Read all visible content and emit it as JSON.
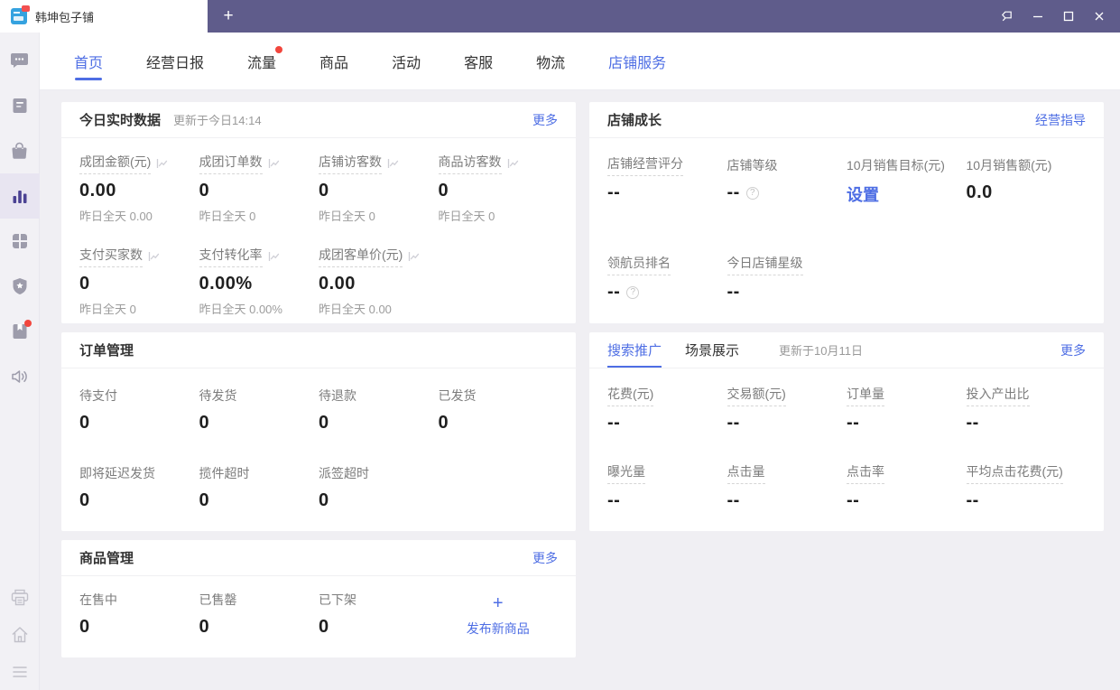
{
  "colors": {
    "accent_blue": "#4e6ee4",
    "titlebar_purple": "#5f5c8b",
    "sidebar_active_purple": "#4b4293",
    "badge_red": "#f2463d"
  },
  "window": {
    "tab_title": "韩坤包子铺",
    "new_tab_label": "+"
  },
  "sidebar": {
    "top_icons": [
      "chat-icon",
      "document-icon",
      "bag-icon",
      "bar-chart-icon",
      "grid-icon",
      "shield-icon",
      "book-icon",
      "speaker-icon"
    ],
    "active_icon": "bar-chart-icon",
    "bottom_icons": [
      "printer-icon",
      "home-icon",
      "menu-icon"
    ]
  },
  "nav": {
    "tabs": [
      {
        "label": "首页",
        "active": true
      },
      {
        "label": "经营日报"
      },
      {
        "label": "流量",
        "badge": true
      },
      {
        "label": "商品"
      },
      {
        "label": "活动"
      },
      {
        "label": "客服"
      },
      {
        "label": "物流"
      },
      {
        "label": "店铺服务",
        "highlight": true
      }
    ]
  },
  "realtime": {
    "title": "今日实时数据",
    "updated": "更新于今日14:14",
    "more": "更多",
    "metrics": [
      {
        "label": "成团金额(元)",
        "dashed": true,
        "chart_icon": true,
        "value": "0.00",
        "sub": "昨日全天 0.00"
      },
      {
        "label": "成团订单数",
        "dashed": true,
        "chart_icon": true,
        "value": "0",
        "sub": "昨日全天 0"
      },
      {
        "label": "店铺访客数",
        "dashed": true,
        "chart_icon": true,
        "value": "0",
        "sub": "昨日全天 0"
      },
      {
        "label": "商品访客数",
        "dashed": true,
        "chart_icon": true,
        "value": "0",
        "sub": "昨日全天 0"
      },
      {
        "label": "支付买家数",
        "dashed": true,
        "chart_icon": true,
        "value": "0",
        "sub": "昨日全天 0"
      },
      {
        "label": "支付转化率",
        "dashed": true,
        "chart_icon": true,
        "value": "0.00%",
        "sub": "昨日全天 0.00%"
      },
      {
        "label": "成团客单价(元)",
        "dashed": true,
        "chart_icon": true,
        "value": "0.00",
        "sub": "昨日全天 0.00"
      }
    ]
  },
  "growth": {
    "title": "店铺成长",
    "link": "经营指导",
    "metrics": [
      {
        "label": "店铺经营评分",
        "dashed": true,
        "value": "--"
      },
      {
        "label": "店铺等级",
        "value": "--",
        "help": true
      },
      {
        "label": "10月销售目标(元)",
        "action": "设置"
      },
      {
        "label": "10月销售额(元)",
        "value": "0.0"
      },
      {
        "label": "领航员排名",
        "dashed": true,
        "value": "--",
        "help": true
      },
      {
        "label": "今日店铺星级",
        "dashed": true,
        "value": "--"
      }
    ]
  },
  "orders": {
    "title": "订单管理",
    "metrics": [
      {
        "label": "待支付",
        "value": "0"
      },
      {
        "label": "待发货",
        "value": "0"
      },
      {
        "label": "待退款",
        "value": "0"
      },
      {
        "label": "已发货",
        "value": "0"
      },
      {
        "label": "即将延迟发货",
        "value": "0"
      },
      {
        "label": "揽件超时",
        "value": "0"
      },
      {
        "label": "派签超时",
        "value": "0"
      }
    ]
  },
  "promotion": {
    "tabs": [
      {
        "label": "搜索推广",
        "active": true
      },
      {
        "label": "场景展示"
      }
    ],
    "updated": "更新于10月11日",
    "more": "更多",
    "metrics": [
      {
        "label": "花费(元)",
        "dashed": true,
        "value": "--"
      },
      {
        "label": "交易额(元)",
        "dashed": true,
        "value": "--"
      },
      {
        "label": "订单量",
        "dashed": true,
        "value": "--"
      },
      {
        "label": "投入产出比",
        "dashed": true,
        "value": "--"
      },
      {
        "label": "曝光量",
        "dashed": true,
        "value": "--"
      },
      {
        "label": "点击量",
        "dashed": true,
        "value": "--"
      },
      {
        "label": "点击率",
        "dashed": true,
        "value": "--"
      },
      {
        "label": "平均点击花费(元)",
        "dashed": true,
        "value": "--"
      }
    ]
  },
  "goods": {
    "title": "商品管理",
    "more": "更多",
    "metrics": [
      {
        "label": "在售中",
        "value": "0"
      },
      {
        "label": "已售罄",
        "value": "0"
      },
      {
        "label": "已下架",
        "value": "0"
      }
    ],
    "publish": {
      "icon": "+",
      "label": "发布新商品"
    }
  }
}
